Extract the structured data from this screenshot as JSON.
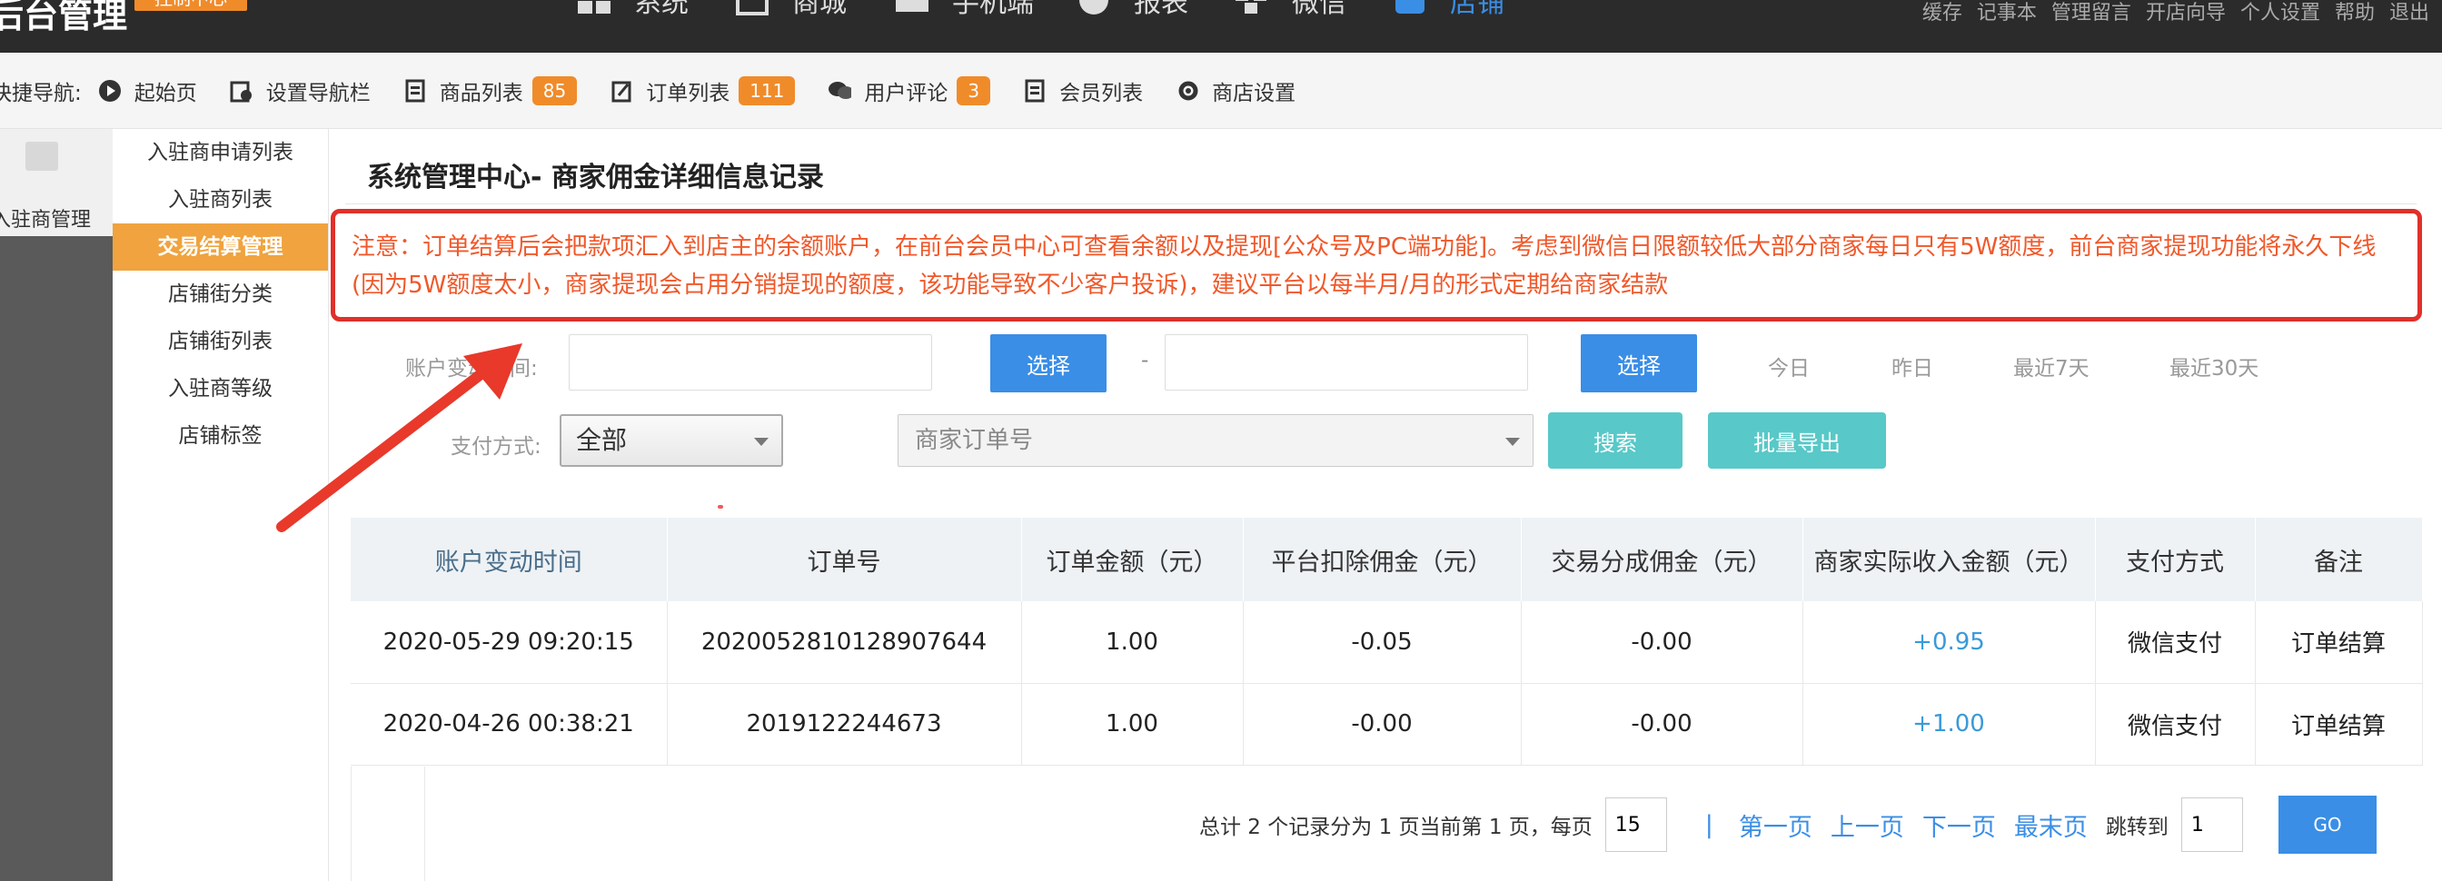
{
  "header": {
    "brand": "后台管理",
    "brand_badge": "控制中心",
    "nav": [
      {
        "label": "系统",
        "icon": "grid-icon"
      },
      {
        "label": "商城",
        "icon": "square-icon"
      },
      {
        "label": "手机端",
        "icon": "printer-icon"
      },
      {
        "label": "报表",
        "icon": "pie-icon"
      },
      {
        "label": "微信",
        "icon": "puzzle-icon"
      },
      {
        "label": "店铺",
        "icon": "shop-icon"
      }
    ],
    "links": [
      "缓存",
      "记事本",
      "管理留言",
      "开店向导",
      "个人设置",
      "帮助",
      "退出"
    ]
  },
  "quicknav": {
    "title": "快捷导航:",
    "items": [
      {
        "label": "起始页",
        "icon": "play-icon"
      },
      {
        "label": "设置导航栏",
        "icon": "settings-icon"
      },
      {
        "label": "商品列表",
        "icon": "clipboard-icon",
        "badge": "85"
      },
      {
        "label": "订单列表",
        "icon": "edit-icon",
        "badge": "111"
      },
      {
        "label": "用户评论",
        "icon": "chat-icon",
        "badge": "3"
      },
      {
        "label": "会员列表",
        "icon": "clipboard-icon"
      },
      {
        "label": "商店设置",
        "icon": "gear-icon"
      }
    ]
  },
  "sidebar": {
    "section_label": "入驻商管理",
    "items": [
      {
        "label": "入驻商申请列表"
      },
      {
        "label": "入驻商列表"
      },
      {
        "label": "交易结算管理",
        "active": true
      },
      {
        "label": "店铺街分类"
      },
      {
        "label": "店铺街列表"
      },
      {
        "label": "入驻商等级"
      },
      {
        "label": "店铺标签"
      }
    ]
  },
  "main": {
    "title": "系统管理中心- 商家佣金详细信息记录",
    "notice": "注意：订单结算后会把款项汇入到店主的余额账户，在前台会员中心可查看余额以及提现[公众号及PC端功能]。考虑到微信日限额较低大部分商家每日只有5W额度，前台商家提现功能将永久下线(因为5W额度太小，商家提现会占用分销提现的额度，该功能导致不少客户投诉)，建议平台以每半月/月的形式定期给商家结款",
    "filters": {
      "time_label": "账户变动时间:",
      "select_btn": "选择",
      "dash": "-",
      "quick_dates": [
        "今日",
        "昨日",
        "最近7天",
        "最近30天"
      ],
      "pay_label": "支付方式:",
      "pay_value": "全部",
      "order_placeholder": "商家订单号",
      "search_btn": "搜索",
      "export_btn": "批量导出"
    },
    "table": {
      "headers": [
        "账户变动时间",
        "订单号",
        "订单金额（元）",
        "平台扣除佣金（元）",
        "交易分成佣金（元）",
        "商家实际收入金额（元）",
        "支付方式",
        "备注"
      ],
      "rows": [
        [
          "2020-05-29 09:20:15",
          "2020052810128907644",
          "1.00",
          "-0.05",
          "-0.00",
          "+0.95",
          "微信支付",
          "订单结算"
        ],
        [
          "2020-04-26 00:38:21",
          "2019122244673",
          "1.00",
          "-0.00",
          "-0.00",
          "+1.00",
          "微信支付",
          "订单结算"
        ]
      ]
    },
    "pager": {
      "summary": "总计 2 个记录分为 1 页当前第 1 页，每页",
      "per_page": "15",
      "sep": "|",
      "first": "第一页",
      "prev": "上一页",
      "next": "下一页",
      "last": "最末页",
      "jump_label": "跳转到",
      "jump_value": "1",
      "go": "GO"
    }
  },
  "colors": {
    "accent": "#3a8ee6",
    "orange": "#f08b2a",
    "notice_border": "#e0302a",
    "notice_text": "#f0582a",
    "teal": "#58c8c8"
  }
}
